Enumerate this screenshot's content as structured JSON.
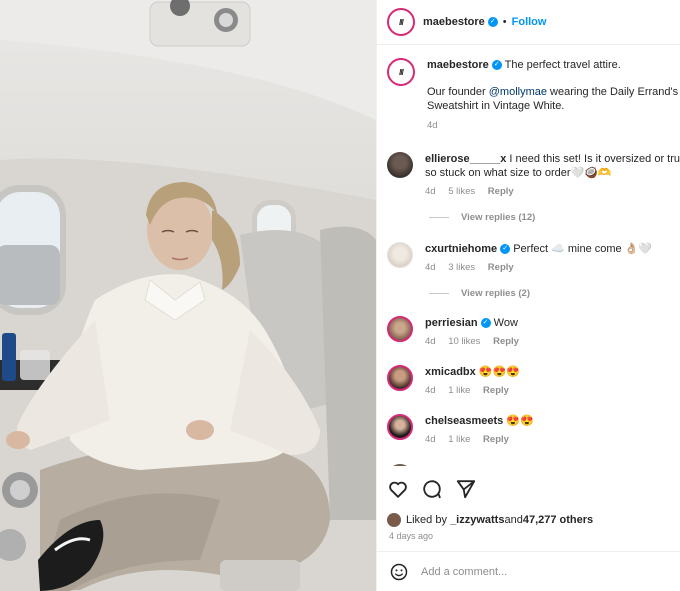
{
  "header": {
    "username": "maebestore",
    "follow_label": "Follow"
  },
  "caption": {
    "username": "maebestore",
    "text_start": "The perfect travel attire.",
    "line2_prefix": "Our founder ",
    "mention": "@mollymae",
    "line2_suffix": " wearing the Daily Errand's C",
    "line3": "Sweatshirt in Vintage White.",
    "time": "4d"
  },
  "comments": [
    {
      "username": "ellierose_____x",
      "text": "I need this set! Is it oversized or tru",
      "text2": "so stuck on what size to order🤍🥥🫶",
      "time": "4d",
      "likes": "5 likes",
      "reply": "Reply",
      "view_replies": "View replies (12)"
    },
    {
      "username": "cxurtniehome",
      "text": "Perfect ☁️ mine come 👌🏼🤍",
      "time": "4d",
      "likes": "3 likes",
      "reply": "Reply",
      "view_replies": "View replies (2)"
    },
    {
      "username": "perriesian",
      "text": "Wow",
      "time": "4d",
      "likes": "10 likes",
      "reply": "Reply"
    },
    {
      "username": "xmicadbx",
      "text": "😍😍😍",
      "time": "4d",
      "likes": "1 like",
      "reply": "Reply"
    },
    {
      "username": "chelseasmeets",
      "text": "😍😍",
      "time": "4d",
      "likes": "1 like",
      "reply": "Reply"
    }
  ],
  "likes": {
    "prefix": "Liked by ",
    "user": "_izzywatts",
    "middle": " and ",
    "count": "47,277 others"
  },
  "date": "4 days ago",
  "add_comment_placeholder": "Add a comment...",
  "icons": {
    "like": "heart-icon",
    "comment": "comment-icon",
    "share": "share-icon",
    "emoji": "emoji-icon"
  },
  "colors": {
    "follow": "#0095f6",
    "verified": "#0095f6",
    "story_ring": "#d62976"
  }
}
